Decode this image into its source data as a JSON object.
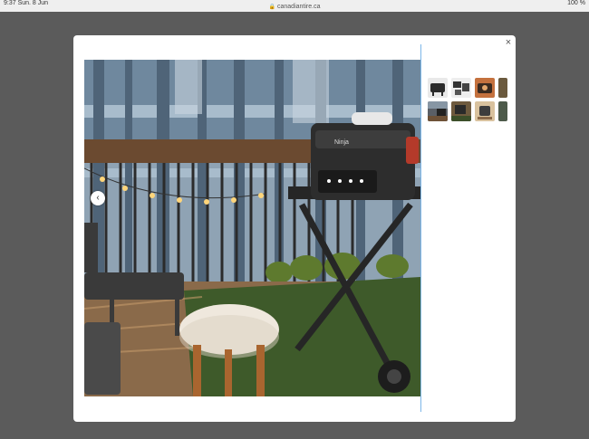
{
  "status_bar": {
    "left_text": "9:37  Sun. 8 Jun",
    "right_text": "100 %"
  },
  "url": "canadiantire.ca",
  "modal": {
    "close_glyph": "×",
    "prev_glyph": "‹",
    "grill_brand": "Ninja"
  },
  "thumbnails": [
    {
      "name": "grill-front"
    },
    {
      "name": "grill-parts"
    },
    {
      "name": "grill-food"
    },
    {
      "name": "grill-partial"
    },
    {
      "name": "balcony-1"
    },
    {
      "name": "balcony-2"
    },
    {
      "name": "balcony-3"
    },
    {
      "name": "balcony-4"
    }
  ],
  "colors": {
    "overlay": "#5b5b5b",
    "modal_bg": "#ffffff",
    "divider": "#7cb6e8"
  }
}
